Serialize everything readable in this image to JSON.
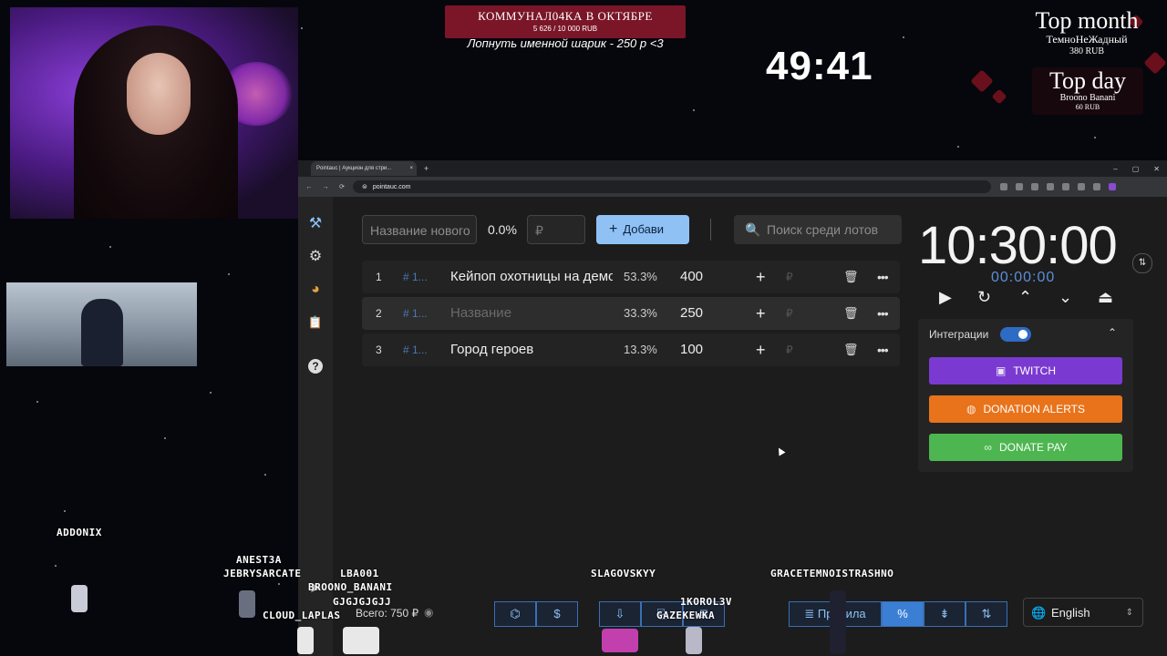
{
  "stream": {
    "goal": {
      "title": "КОММУНАЛ04КА В ОКТЯБРЕ",
      "amount": "5 626 / 10 000 RUB",
      "note": "Лопнуть именной шарик - 250 р <3"
    },
    "timer": "49:41",
    "top_month": {
      "title": "Top month",
      "name": "ТемноНеЖадный",
      "amount": "380 RUB"
    },
    "top_day": {
      "title": "Top day",
      "name": "Broono Banani",
      "amount": "60 RUB"
    }
  },
  "browser": {
    "tab_title": "Pointauc | Аукцион для стри...",
    "tab_close": "×",
    "new_tab": "+",
    "url": "pointauc.com",
    "window_buttons": [
      "–",
      "▢",
      "✕"
    ],
    "nav": [
      "←",
      "→",
      "⟳",
      "⊜"
    ]
  },
  "app": {
    "sidebar_icons": [
      "hammer-icon",
      "gear-icon",
      "pie-chart-icon",
      "clipboard-icon",
      "help-icon",
      "telegram-icon"
    ],
    "sidebar_glyphs": {
      "hammer": "⚒",
      "gear": "⚙",
      "pie": "◕",
      "clipboard": "📋",
      "help": "?",
      "telegram": "➤"
    },
    "new_lot_placeholder": "Название нового",
    "new_lot_percent": "0.0%",
    "currency_placeholder": "₽",
    "add_button": "Добави",
    "add_plus": "+",
    "search_placeholder": "Поиск среди лотов",
    "search_glyph": "🔍",
    "lots": [
      {
        "num": "1",
        "id": "# 1...",
        "name": "Кейпоп охотницы на демонов",
        "percent": "53.3%",
        "amount": "400"
      },
      {
        "num": "2",
        "id": "# 1...",
        "name": "Название",
        "percent": "33.3%",
        "amount": "250"
      },
      {
        "num": "3",
        "id": "# 1...",
        "name": "Город героев",
        "percent": "13.3%",
        "amount": "100"
      }
    ],
    "row_glyphs": {
      "plus": "+",
      "rub": "₽",
      "trash": "🗑",
      "more": "•••"
    },
    "clock": "10:30:00",
    "clock_sub": "00:00:00",
    "clock_swap": "⇅",
    "controls": {
      "play": "▶",
      "reset": "↻",
      "up": "⌃",
      "down": "⌄",
      "top": "⏏"
    },
    "integrations": {
      "title": "Интеграции",
      "collapse": "⌃",
      "twitch": "TWITCH",
      "donation_alerts": "DONATION ALERTS",
      "donate_pay": "DONATE PAY"
    },
    "total": "Всего: 750 ₽",
    "eye": "◉",
    "bottom_left": [
      "⌬",
      "$"
    ],
    "bottom_mid": [
      "⇩",
      "⎘",
      "≣"
    ],
    "bottom_right": {
      "rules_icon": "≣",
      "rules": "Правила",
      "percent": "%",
      "split": "⇟",
      "sort": "⇅"
    },
    "language": "English",
    "lang_glyph": "🌐",
    "lang_arrows": "⇕"
  },
  "chat_names": [
    "ADDONIX",
    "ANEST3A",
    "JEBRYSARCATE",
    "LBA001",
    "BROONO_BANANI",
    "GJGJGJGJJ",
    "CLOUD_LAPLAS",
    "SLAGOVSKYY",
    "1KOROL3V",
    "GAZEKEWKA",
    "GRACETEMNOISTRASHNO"
  ],
  "colors": {
    "accent": "#8fc1f5",
    "twitch": "#7a3ad1",
    "donation_alerts": "#e8731b",
    "donate_pay": "#4db650",
    "goal_bg": "#7a1628"
  }
}
